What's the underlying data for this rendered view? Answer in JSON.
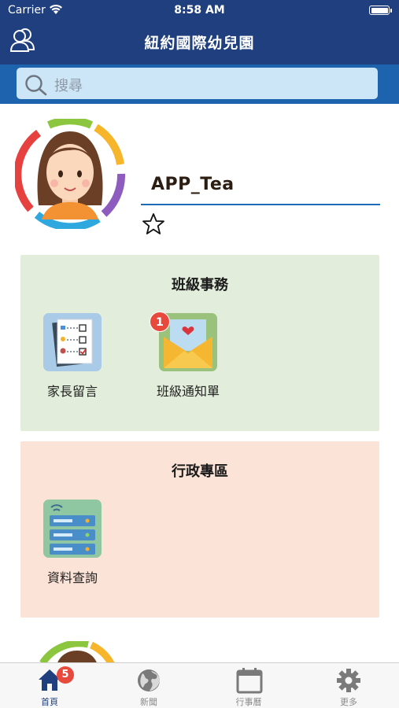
{
  "status_bar": {
    "carrier": "Carrier",
    "time": "8:58 AM"
  },
  "nav": {
    "title": "紐約國際幼兒園",
    "left_icon": "contacts-icon"
  },
  "search": {
    "placeholder": "搜尋"
  },
  "profile": {
    "username": "APP_Tea",
    "favorite_icon": "star-outline-icon"
  },
  "sections": [
    {
      "title": "班級事務",
      "items": [
        {
          "label": "家長留言",
          "icon": "checklist-icon"
        },
        {
          "label": "班級通知單",
          "icon": "envelope-heart-icon",
          "badge": "1"
        }
      ]
    },
    {
      "title": "行政專區",
      "items": [
        {
          "label": "資料查詢",
          "icon": "server-icon"
        }
      ]
    }
  ],
  "tabs": [
    {
      "label": "首頁",
      "icon": "home-icon",
      "badge": "5",
      "active": true
    },
    {
      "label": "新聞",
      "icon": "globe-icon"
    },
    {
      "label": "行事曆",
      "icon": "calendar-icon"
    },
    {
      "label": "更多",
      "icon": "gear-icon"
    }
  ],
  "colors": {
    "nav": "#1f3f7e",
    "search_bar": "#1d63ad",
    "section1_bg": "#e2eedb",
    "section2_bg": "#fbe3d7",
    "badge": "#e74a3c"
  }
}
